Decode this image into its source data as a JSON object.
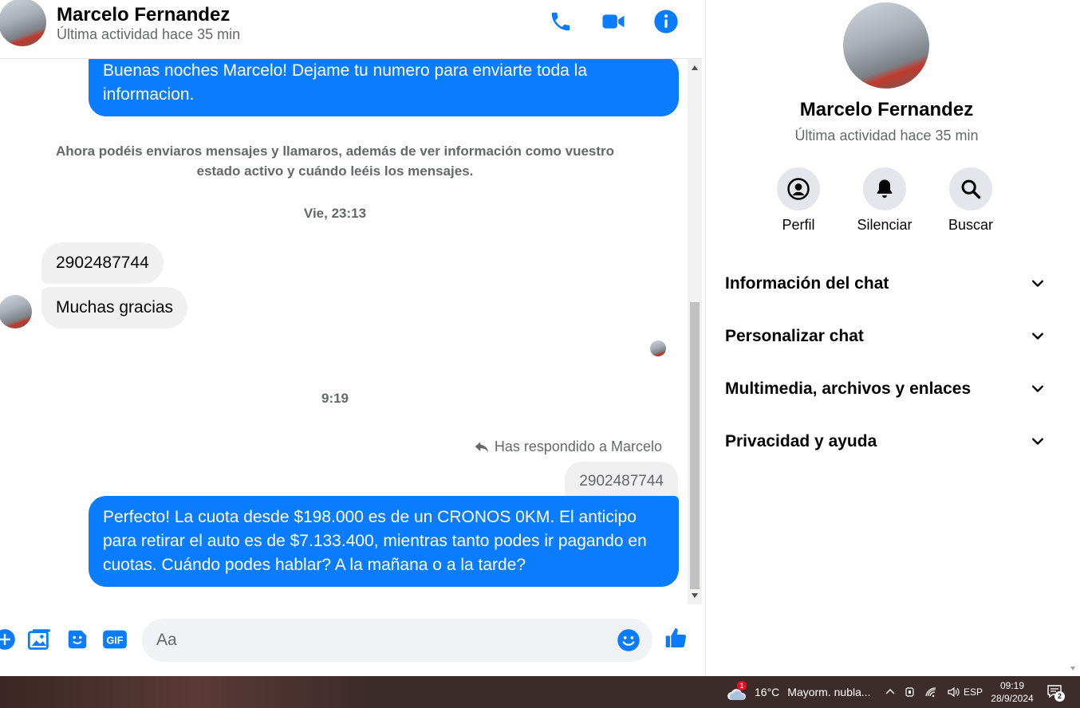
{
  "header": {
    "contact_name": "Marcelo Fernandez",
    "status": "Última actividad hace 35 min",
    "icons": [
      "phone-icon",
      "video-icon",
      "info-icon"
    ]
  },
  "messages": {
    "m1_out": "Buenas noches Marcelo! Dejame tu numero para enviarte toda la informacion.",
    "system_notice": "Ahora podéis enviaros mensajes y llamaros, además de ver información como vuestro estado activo y cuándo leéis los mensajes.",
    "timestamp_1": "Vie, 23:13",
    "m2_in": "2902487744",
    "m3_in": "Muchas gracias",
    "timestamp_2": "9:19",
    "reply_note": "Has respondido a Marcelo",
    "quoted_text": "2902487744",
    "m4_out": "Perfecto! La cuota desde $198.000 es de un CRONOS 0KM. El anticipo para retirar el auto es de $7.133.400, mientras tanto podes ir pagando en cuotas. Cuándo podes hablar? A la mañana o a la tarde?"
  },
  "composer": {
    "placeholder": "Aa",
    "icons": [
      "plus-icon",
      "image-icon",
      "sticker-icon",
      "gif-icon",
      "emoji-icon",
      "like-icon"
    ],
    "gif_label": "GIF"
  },
  "panel": {
    "name": "Marcelo Fernandez",
    "status": "Última actividad hace 35 min",
    "actions": [
      {
        "label": "Perfil",
        "icon": "profile-icon"
      },
      {
        "label": "Silenciar",
        "icon": "bell-icon"
      },
      {
        "label": "Buscar",
        "icon": "search-icon"
      }
    ],
    "sections": [
      "Información del chat",
      "Personalizar chat",
      "Multimedia, archivos y enlaces",
      "Privacidad y ayuda"
    ]
  },
  "taskbar": {
    "weather_temp": "16°C",
    "weather_desc": "Mayorm. nubla...",
    "weather_badge": "1",
    "language": "ESP",
    "time": "09:19",
    "date": "28/9/2024",
    "notification_count": "2"
  },
  "colors": {
    "accent": "#0a7cff",
    "bubble_in": "#f0f0f0",
    "secondary_text": "#65676b"
  }
}
